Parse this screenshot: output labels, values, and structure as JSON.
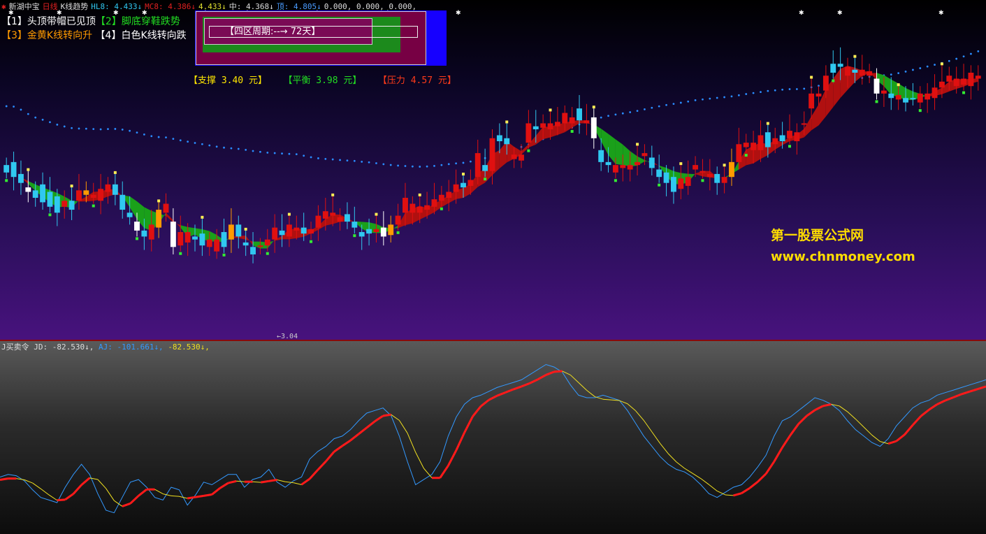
{
  "header": {
    "title": "新湖中宝",
    "period": "日线",
    "indicator": "K线趋势",
    "hl8_label": "HL8: 4.433↓",
    "mc8_label": "MC8: 4.386↓",
    "mid_val": "4.433↓",
    "zhong_label": "中: 4.368↓",
    "ding_label": "顶: 4.805↓",
    "zeros": "0.000, 0.000, 0.000,"
  },
  "signals": {
    "s1": "【1】头顶带帽已见顶",
    "s2": "【2】脚底穿鞋跌势",
    "s3": "【3】金黄K线转向升",
    "s4": "【4】白色K线转向跌"
  },
  "info_box": {
    "label": "【四区周期:--→ 72天】"
  },
  "levels": {
    "support": "【支撑 3.40 元】",
    "balance": "【平衡 3.98 元】",
    "pressure": "【压力 4.57 元】"
  },
  "watermark": {
    "line1": "第一股票公式网",
    "line2": "www.chnmoney.com"
  },
  "low_label": "←3.04",
  "indicator_panel": {
    "title": "J买卖令",
    "jd_label": "JD: -82.530↓,",
    "aj_label": "AJ: -101.661↓,",
    "last_label": "-82.530↓,"
  },
  "colors": {
    "bull": "#e01010",
    "bear": "#30c8f0",
    "gold": "#ff9a00",
    "white": "#ffffff",
    "dotted_line": "#2a8cff",
    "band_green": "#1aa01a",
    "band_red": "#b01010",
    "j_blue": "#3399ff",
    "j_yellow": "#f0e020",
    "j_red": "#ff1a1a"
  },
  "chart_data": {
    "type": "candlestick",
    "y_min_label": "3.04",
    "candles": [
      {
        "o": 4.1,
        "c": 4.05,
        "t": "bear"
      },
      {
        "o": 4.12,
        "c": 4.02,
        "t": "bear"
      },
      {
        "o": 4.04,
        "c": 3.98,
        "t": "bear"
      },
      {
        "o": 3.95,
        "c": 3.92,
        "t": "white"
      },
      {
        "o": 3.93,
        "c": 3.88,
        "t": "bear"
      },
      {
        "o": 3.97,
        "c": 3.85,
        "t": "bear"
      },
      {
        "o": 3.92,
        "c": 3.82,
        "t": "bear"
      },
      {
        "o": 3.89,
        "c": 3.78,
        "t": "bear"
      },
      {
        "o": 3.82,
        "c": 3.86,
        "t": "bull"
      },
      {
        "o": 3.86,
        "c": 3.8,
        "t": "bear"
      },
      {
        "o": 3.86,
        "c": 3.93,
        "t": "bull"
      },
      {
        "o": 3.9,
        "c": 3.93,
        "t": "gold"
      },
      {
        "o": 3.88,
        "c": 3.9,
        "t": "bull"
      },
      {
        "o": 3.86,
        "c": 3.94,
        "t": "bull"
      },
      {
        "o": 3.92,
        "c": 3.97,
        "t": "bull"
      },
      {
        "o": 3.97,
        "c": 3.9,
        "t": "bear"
      },
      {
        "o": 3.9,
        "c": 3.8,
        "t": "bear"
      },
      {
        "o": 3.78,
        "c": 3.75,
        "t": "bear"
      },
      {
        "o": 3.72,
        "c": 3.66,
        "t": "white"
      },
      {
        "o": 3.66,
        "c": 3.62,
        "t": "bear"
      },
      {
        "o": 3.6,
        "c": 3.7,
        "t": "bull"
      },
      {
        "o": 3.68,
        "c": 3.8,
        "t": "gold"
      },
      {
        "o": 3.78,
        "c": 3.84,
        "t": "bull"
      },
      {
        "o": 3.72,
        "c": 3.55,
        "t": "white"
      },
      {
        "o": 3.56,
        "c": 3.65,
        "t": "bull"
      },
      {
        "o": 3.58,
        "c": 3.65,
        "t": "bull"
      },
      {
        "o": 3.62,
        "c": 3.6,
        "t": "bear"
      },
      {
        "o": 3.64,
        "c": 3.56,
        "t": "bear"
      },
      {
        "o": 3.55,
        "c": 3.6,
        "t": "bull"
      },
      {
        "o": 3.52,
        "c": 3.6,
        "t": "bull"
      },
      {
        "o": 3.65,
        "c": 3.55,
        "t": "bear"
      },
      {
        "o": 3.6,
        "c": 3.7,
        "t": "gold"
      },
      {
        "o": 3.7,
        "c": 3.62,
        "t": "bear"
      },
      {
        "o": 3.58,
        "c": 3.56,
        "t": "bear"
      },
      {
        "o": 3.55,
        "c": 3.5,
        "t": "bear"
      },
      {
        "o": 3.55,
        "c": 3.56,
        "t": "bull"
      },
      {
        "o": 3.6,
        "c": 3.56,
        "t": "bull"
      },
      {
        "o": 3.6,
        "c": 3.68,
        "t": "bull"
      },
      {
        "o": 3.66,
        "c": 3.63,
        "t": "bear"
      },
      {
        "o": 3.62,
        "c": 3.7,
        "t": "bull"
      },
      {
        "o": 3.66,
        "c": 3.68,
        "t": "bull"
      },
      {
        "o": 3.68,
        "c": 3.64,
        "t": "bear"
      },
      {
        "o": 3.64,
        "c": 3.67,
        "t": "bull"
      },
      {
        "o": 3.68,
        "c": 3.76,
        "t": "bull"
      },
      {
        "o": 3.74,
        "c": 3.79,
        "t": "bull"
      },
      {
        "o": 3.78,
        "c": 3.76,
        "t": "bull"
      },
      {
        "o": 3.72,
        "c": 3.75,
        "t": "bull"
      },
      {
        "o": 3.77,
        "c": 3.72,
        "t": "bear"
      },
      {
        "o": 3.72,
        "c": 3.68,
        "t": "bear"
      },
      {
        "o": 3.65,
        "c": 3.62,
        "t": "bear"
      },
      {
        "o": 3.67,
        "c": 3.64,
        "t": "bear"
      },
      {
        "o": 3.65,
        "c": 3.67,
        "t": "bull"
      },
      {
        "o": 3.68,
        "c": 3.62,
        "t": "white"
      },
      {
        "o": 3.63,
        "c": 3.7,
        "t": "gold"
      },
      {
        "o": 3.7,
        "c": 3.76,
        "t": "bull"
      },
      {
        "o": 3.78,
        "c": 3.88,
        "t": "bull"
      },
      {
        "o": 3.84,
        "c": 3.78,
        "t": "bull"
      },
      {
        "o": 3.78,
        "c": 3.82,
        "t": "bull"
      },
      {
        "o": 3.8,
        "c": 3.83,
        "t": "bull"
      },
      {
        "o": 3.82,
        "c": 3.87,
        "t": "bull"
      },
      {
        "o": 3.86,
        "c": 3.9,
        "t": "bull"
      },
      {
        "o": 3.88,
        "c": 3.92,
        "t": "bull"
      },
      {
        "o": 3.92,
        "c": 3.97,
        "t": "bull"
      },
      {
        "o": 3.98,
        "c": 3.95,
        "t": "bear"
      },
      {
        "o": 3.96,
        "c": 4.0,
        "t": "bull"
      },
      {
        "o": 4.02,
        "c": 4.18,
        "t": "bull"
      },
      {
        "o": 4.1,
        "c": 4.06,
        "t": "bear"
      },
      {
        "o": 4.06,
        "c": 4.28,
        "t": "bull"
      },
      {
        "o": 4.3,
        "c": 4.26,
        "t": "bear"
      },
      {
        "o": 4.28,
        "c": 4.24,
        "t": "bear"
      },
      {
        "o": 4.14,
        "c": 4.17,
        "t": "bull"
      },
      {
        "o": 4.13,
        "c": 4.17,
        "t": "bull"
      },
      {
        "o": 4.25,
        "c": 4.38,
        "t": "bull"
      },
      {
        "o": 4.36,
        "c": 4.34,
        "t": "bear"
      },
      {
        "o": 4.38,
        "c": 4.35,
        "t": "bull"
      },
      {
        "o": 4.34,
        "c": 4.38,
        "t": "bull"
      },
      {
        "o": 4.36,
        "c": 4.39,
        "t": "bull"
      },
      {
        "o": 4.45,
        "c": 4.38,
        "t": "bull"
      },
      {
        "o": 4.38,
        "c": 4.42,
        "t": "bull"
      },
      {
        "o": 4.48,
        "c": 4.4,
        "t": "bear"
      },
      {
        "o": 4.4,
        "c": 4.38,
        "t": "bull"
      },
      {
        "o": 4.42,
        "c": 4.28,
        "t": "white"
      },
      {
        "o": 4.2,
        "c": 4.12,
        "t": "bear"
      },
      {
        "o": 4.12,
        "c": 4.1,
        "t": "bear"
      },
      {
        "o": 4.05,
        "c": 4.1,
        "t": "bull"
      },
      {
        "o": 4.08,
        "c": 4.1,
        "t": "bull"
      },
      {
        "o": 4.1,
        "c": 4.07,
        "t": "bull"
      },
      {
        "o": 4.1,
        "c": 4.12,
        "t": "bull"
      },
      {
        "o": 4.16,
        "c": 4.18,
        "t": "bull"
      },
      {
        "o": 4.15,
        "c": 4.08,
        "t": "bear"
      },
      {
        "o": 4.07,
        "c": 4.02,
        "t": "bear"
      },
      {
        "o": 4.05,
        "c": 3.98,
        "t": "bear"
      },
      {
        "o": 4.02,
        "c": 3.92,
        "t": "bear"
      },
      {
        "o": 3.94,
        "c": 4.01,
        "t": "bull"
      },
      {
        "o": 3.96,
        "c": 4.02,
        "t": "bull"
      },
      {
        "o": 4.07,
        "c": 4.1,
        "t": "bull"
      },
      {
        "o": 4.05,
        "c": 4.06,
        "t": "bull"
      },
      {
        "o": 4.04,
        "c": 4.02,
        "t": "bull"
      },
      {
        "o": 4.04,
        "c": 3.98,
        "t": "bear"
      },
      {
        "o": 3.98,
        "c": 4.02,
        "t": "bull"
      },
      {
        "o": 4.02,
        "c": 4.12,
        "t": "gold"
      },
      {
        "o": 4.12,
        "c": 4.24,
        "t": "bull"
      },
      {
        "o": 4.22,
        "c": 4.25,
        "t": "bull"
      },
      {
        "o": 4.25,
        "c": 4.2,
        "t": "bull"
      },
      {
        "o": 4.2,
        "c": 4.3,
        "t": "bull"
      },
      {
        "o": 4.32,
        "c": 4.22,
        "t": "bear"
      },
      {
        "o": 4.24,
        "c": 4.28,
        "t": "bull"
      },
      {
        "o": 4.3,
        "c": 4.26,
        "t": "bear"
      },
      {
        "o": 4.28,
        "c": 4.33,
        "t": "bull"
      },
      {
        "o": 4.26,
        "c": 4.32,
        "t": "bull"
      },
      {
        "o": 4.38,
        "c": 4.38,
        "t": "bull"
      },
      {
        "o": 4.48,
        "c": 4.58,
        "t": "bull"
      },
      {
        "o": 4.58,
        "c": 4.56,
        "t": "bull"
      },
      {
        "o": 4.6,
        "c": 4.7,
        "t": "bull"
      },
      {
        "o": 4.72,
        "c": 4.78,
        "t": "bear"
      },
      {
        "o": 4.78,
        "c": 4.76,
        "t": "bear"
      },
      {
        "o": 4.7,
        "c": 4.76,
        "t": "bull"
      },
      {
        "o": 4.72,
        "c": 4.74,
        "t": "bear"
      },
      {
        "o": 4.74,
        "c": 4.7,
        "t": "bull"
      },
      {
        "o": 4.7,
        "c": 4.73,
        "t": "bull"
      },
      {
        "o": 4.68,
        "c": 4.58,
        "t": "white"
      },
      {
        "o": 4.6,
        "c": 4.58,
        "t": "bull"
      },
      {
        "o": 4.58,
        "c": 4.55,
        "t": "bear"
      },
      {
        "o": 4.57,
        "c": 4.54,
        "t": "bull"
      },
      {
        "o": 4.55,
        "c": 4.52,
        "t": "bear"
      },
      {
        "o": 4.55,
        "c": 4.55,
        "t": "bear"
      },
      {
        "o": 4.52,
        "c": 4.58,
        "t": "bull"
      },
      {
        "o": 4.54,
        "c": 4.58,
        "t": "bull"
      },
      {
        "o": 4.55,
        "c": 4.62,
        "t": "bull"
      },
      {
        "o": 4.62,
        "c": 4.66,
        "t": "bull"
      },
      {
        "o": 4.66,
        "c": 4.7,
        "t": "bull"
      },
      {
        "o": 4.63,
        "c": 4.68,
        "t": "bull"
      },
      {
        "o": 4.68,
        "c": 4.64,
        "t": "bull"
      },
      {
        "o": 4.63,
        "c": 4.72,
        "t": "bull"
      },
      {
        "o": 4.7,
        "c": 4.68,
        "t": "bull"
      }
    ],
    "j_line": [
      -2,
      0,
      -1,
      -5,
      -12,
      -18,
      -20,
      -22,
      -10,
      0,
      8,
      0,
      -15,
      -28,
      -30,
      -18,
      -6,
      -4,
      -10,
      -18,
      -20,
      -10,
      -12,
      -24,
      -16,
      -6,
      -8,
      -4,
      0,
      0,
      -10,
      -4,
      -2,
      4,
      -6,
      -10,
      -5,
      -2,
      12,
      18,
      22,
      28,
      30,
      35,
      42,
      48,
      50,
      52,
      46,
      30,
      10,
      -8,
      -4,
      0,
      10,
      30,
      45,
      55,
      60,
      62,
      65,
      68,
      70,
      72,
      74,
      78,
      82,
      86,
      84,
      80,
      70,
      62,
      60,
      60,
      62,
      60,
      58,
      50,
      40,
      30,
      22,
      14,
      8,
      4,
      2,
      -2,
      -8,
      -15,
      -18,
      -14,
      -10,
      -8,
      -2,
      6,
      15,
      30,
      42,
      45,
      50,
      55,
      60,
      58,
      55,
      50,
      42,
      35,
      30,
      25,
      22,
      28,
      38,
      45,
      52,
      56,
      58,
      62,
      64,
      66,
      68,
      70,
      72,
      74
    ]
  }
}
